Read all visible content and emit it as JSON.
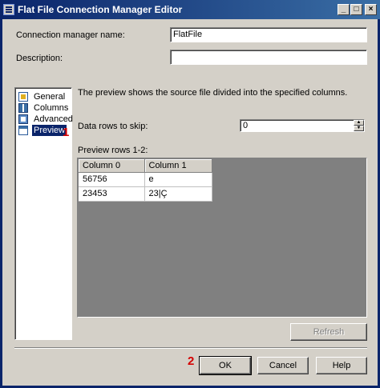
{
  "window": {
    "title": "Flat File Connection Manager Editor",
    "minimize_glyph": "_",
    "maximize_glyph": "□",
    "close_glyph": "×"
  },
  "form": {
    "name_label": "Connection manager name:",
    "name_value": "FlatFile",
    "description_label": "Description:",
    "description_value": ""
  },
  "sidebar": {
    "items": [
      {
        "label": "General",
        "icon": "general-icon"
      },
      {
        "label": "Columns",
        "icon": "columns-icon"
      },
      {
        "label": "Advanced",
        "icon": "advanced-icon"
      },
      {
        "label": "Preview",
        "icon": "preview-icon",
        "selected": true
      }
    ]
  },
  "annotations": {
    "marker_1": "1",
    "marker_2": "2",
    "color": "#d40000"
  },
  "preview": {
    "description": "The preview shows the source file divided into the specified columns.",
    "skip_label": "Data rows to skip:",
    "skip_value": "0",
    "rows_label": "Preview rows 1-2:",
    "columns": [
      "Column 0",
      "Column 1"
    ],
    "rows": [
      [
        "56756",
        "e"
      ],
      [
        "23453",
        "23|Ç"
      ]
    ],
    "refresh_label": "Refresh"
  },
  "buttons": {
    "ok": "OK",
    "cancel": "Cancel",
    "help": "Help"
  },
  "colors": {
    "title_bar": "#0a246a",
    "dialog_bg": "#d4d0c8",
    "selection": "#0a246a"
  }
}
